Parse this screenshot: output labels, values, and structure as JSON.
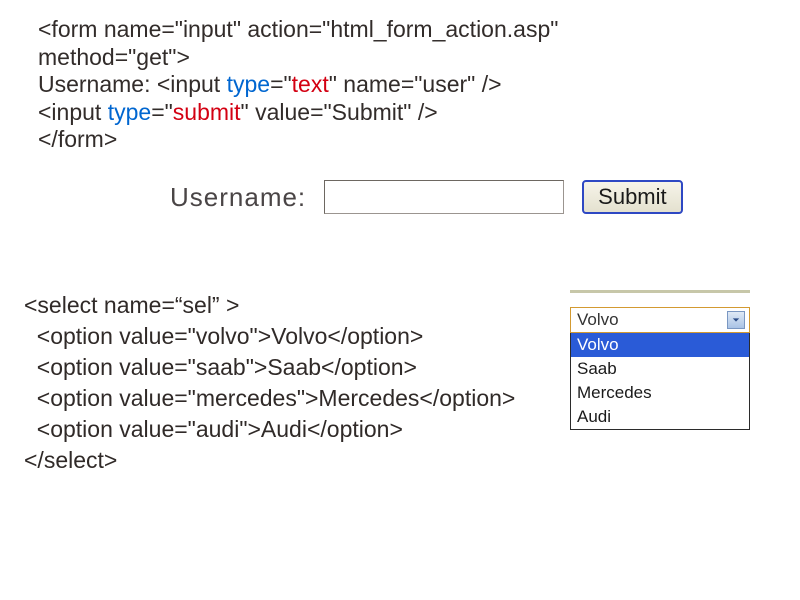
{
  "code1": {
    "line1": {
      "full": "<form name=\"input\" action=\"html_form_action.asp\""
    },
    "line2": {
      "full": "method=\"get\">"
    },
    "line3": {
      "pre": "Username: <input ",
      "kw": "type",
      "eq": "=\"",
      "val": "text",
      "post": "\" name=\"user\" />"
    },
    "line4": {
      "pre": "<input ",
      "kw": "type",
      "eq": "=\"",
      "val": "submit",
      "post": "\" value=\"Submit\" />"
    },
    "line5": {
      "full": "</form>"
    }
  },
  "rendered": {
    "label": "Username:",
    "value": "",
    "button": "Submit"
  },
  "code2": {
    "l1": "<select name=“sel” >",
    "l2": "  <option value=\"volvo\">Volvo</option>",
    "l3": "  <option value=\"saab\">Saab</option>",
    "l4": "  <option value=\"mercedes\">Mercedes</option>",
    "l5": "  <option value=\"audi\">Audi</option>",
    "l6": "</select>"
  },
  "dropdown": {
    "current": "Volvo",
    "options": [
      "Volvo",
      "Saab",
      "Mercedes",
      "Audi"
    ],
    "selectedIndex": 0
  }
}
